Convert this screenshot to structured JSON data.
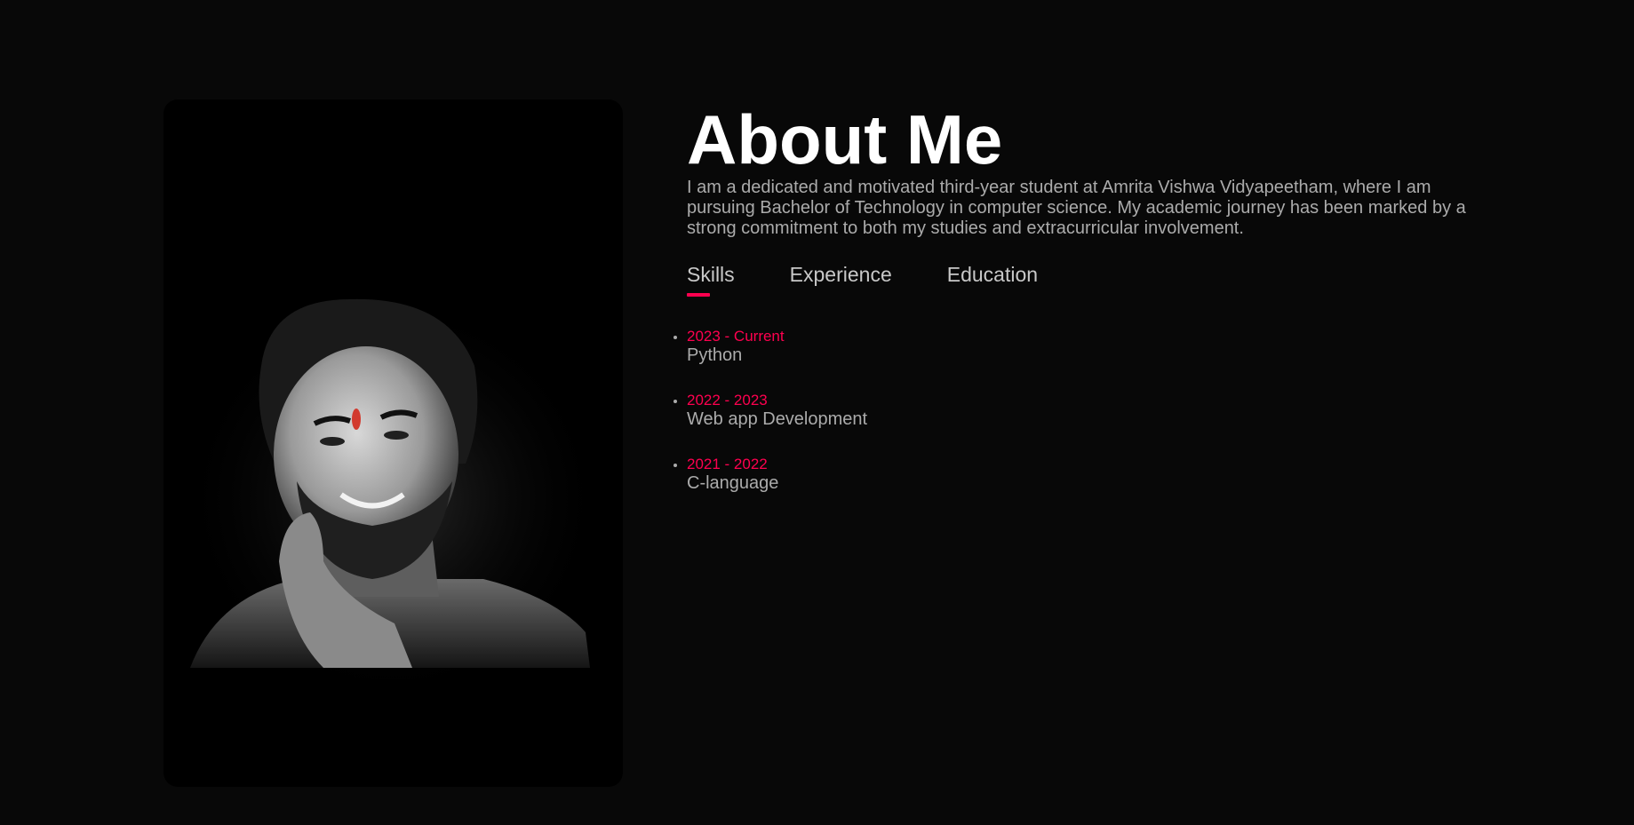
{
  "about": {
    "title": "About Me",
    "intro": "I am a dedicated and motivated third-year student at Amrita Vishwa Vidyapeetham, where I am pursuing Bachelor of Technology in computer science. My academic journey has been marked by a strong commitment to both my studies and extracurricular involvement."
  },
  "tabs": [
    {
      "label": "Skills",
      "active": true
    },
    {
      "label": "Experience",
      "active": false
    },
    {
      "label": "Education",
      "active": false
    }
  ],
  "skills": [
    {
      "period": "2023 - Current",
      "name": "Python"
    },
    {
      "period": "2022 - 2023",
      "name": "Web app Development"
    },
    {
      "period": "2021 - 2022",
      "name": "C-language"
    }
  ],
  "colors": {
    "background": "#080808",
    "accent": "#ff004f",
    "text_muted": "#ababab",
    "heading": "#ffffff"
  }
}
